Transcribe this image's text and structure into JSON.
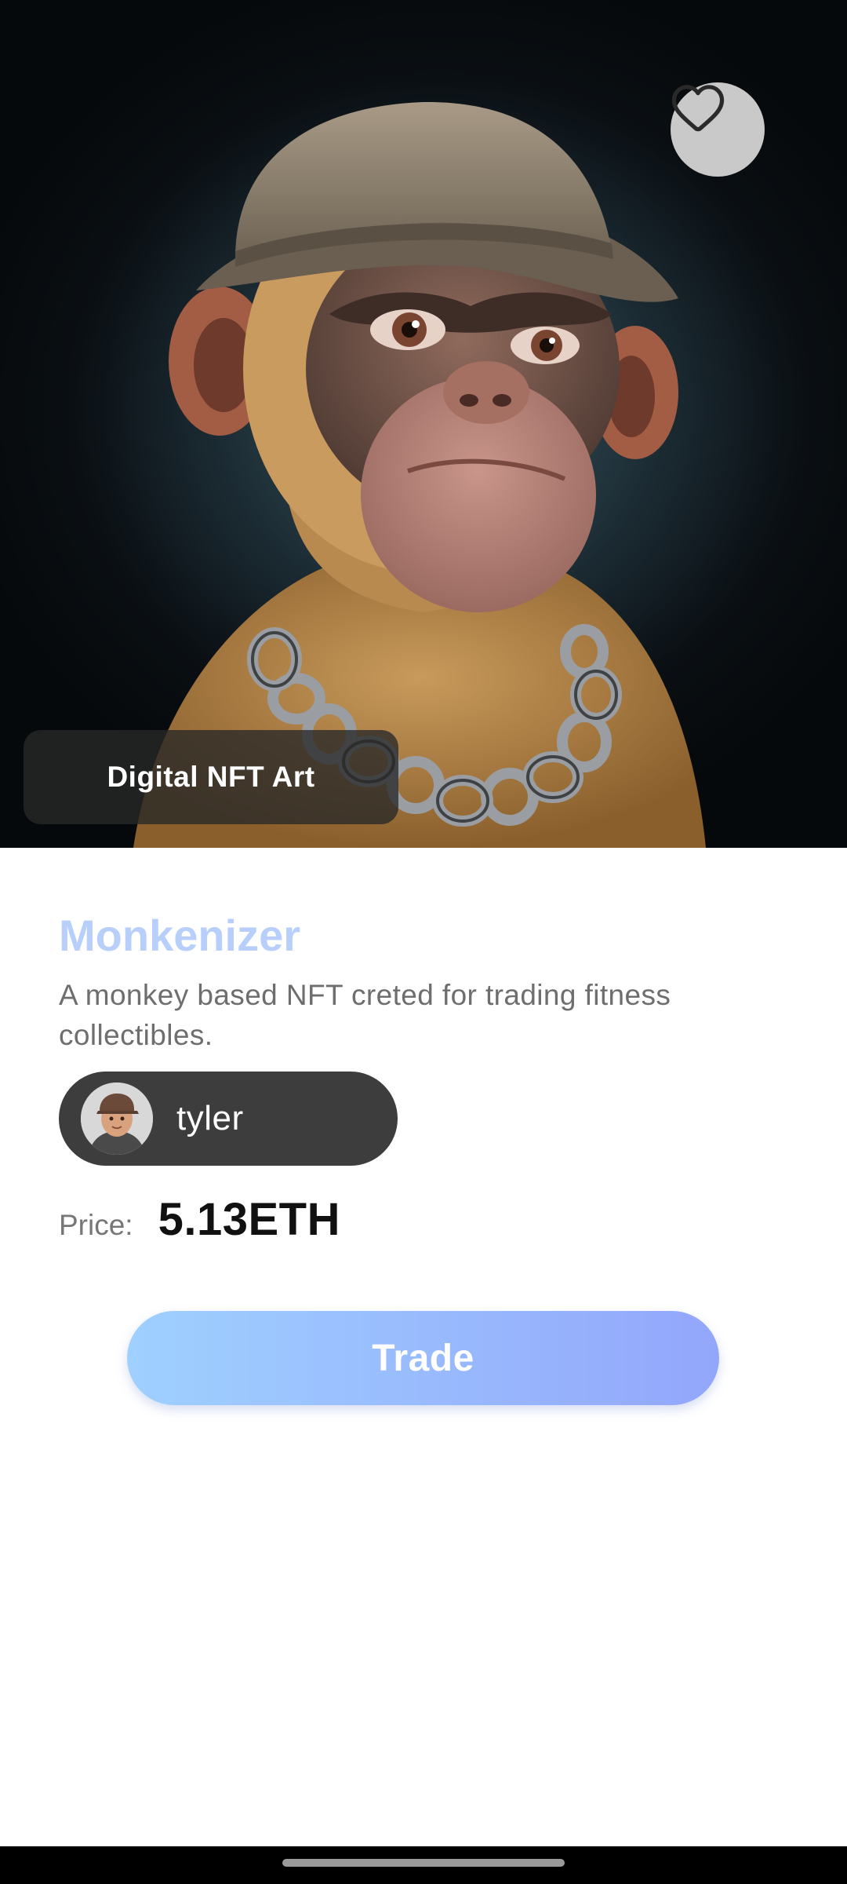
{
  "hero": {
    "tag_label": "Digital NFT Art",
    "favorite_icon": "heart-outline-icon"
  },
  "nft": {
    "title": "Monkenizer",
    "description": "A monkey based NFT creted for trading fitness collectibles."
  },
  "owner": {
    "name": "tyler"
  },
  "price": {
    "label": "Price:",
    "value": "5.13ETH"
  },
  "actions": {
    "trade_label": "Trade"
  },
  "colors": {
    "title": "#b8cffc",
    "trade_gradient_start": "#9fd0ff",
    "trade_gradient_end": "#93a6fb",
    "owner_chip": "#3d3d3d"
  }
}
